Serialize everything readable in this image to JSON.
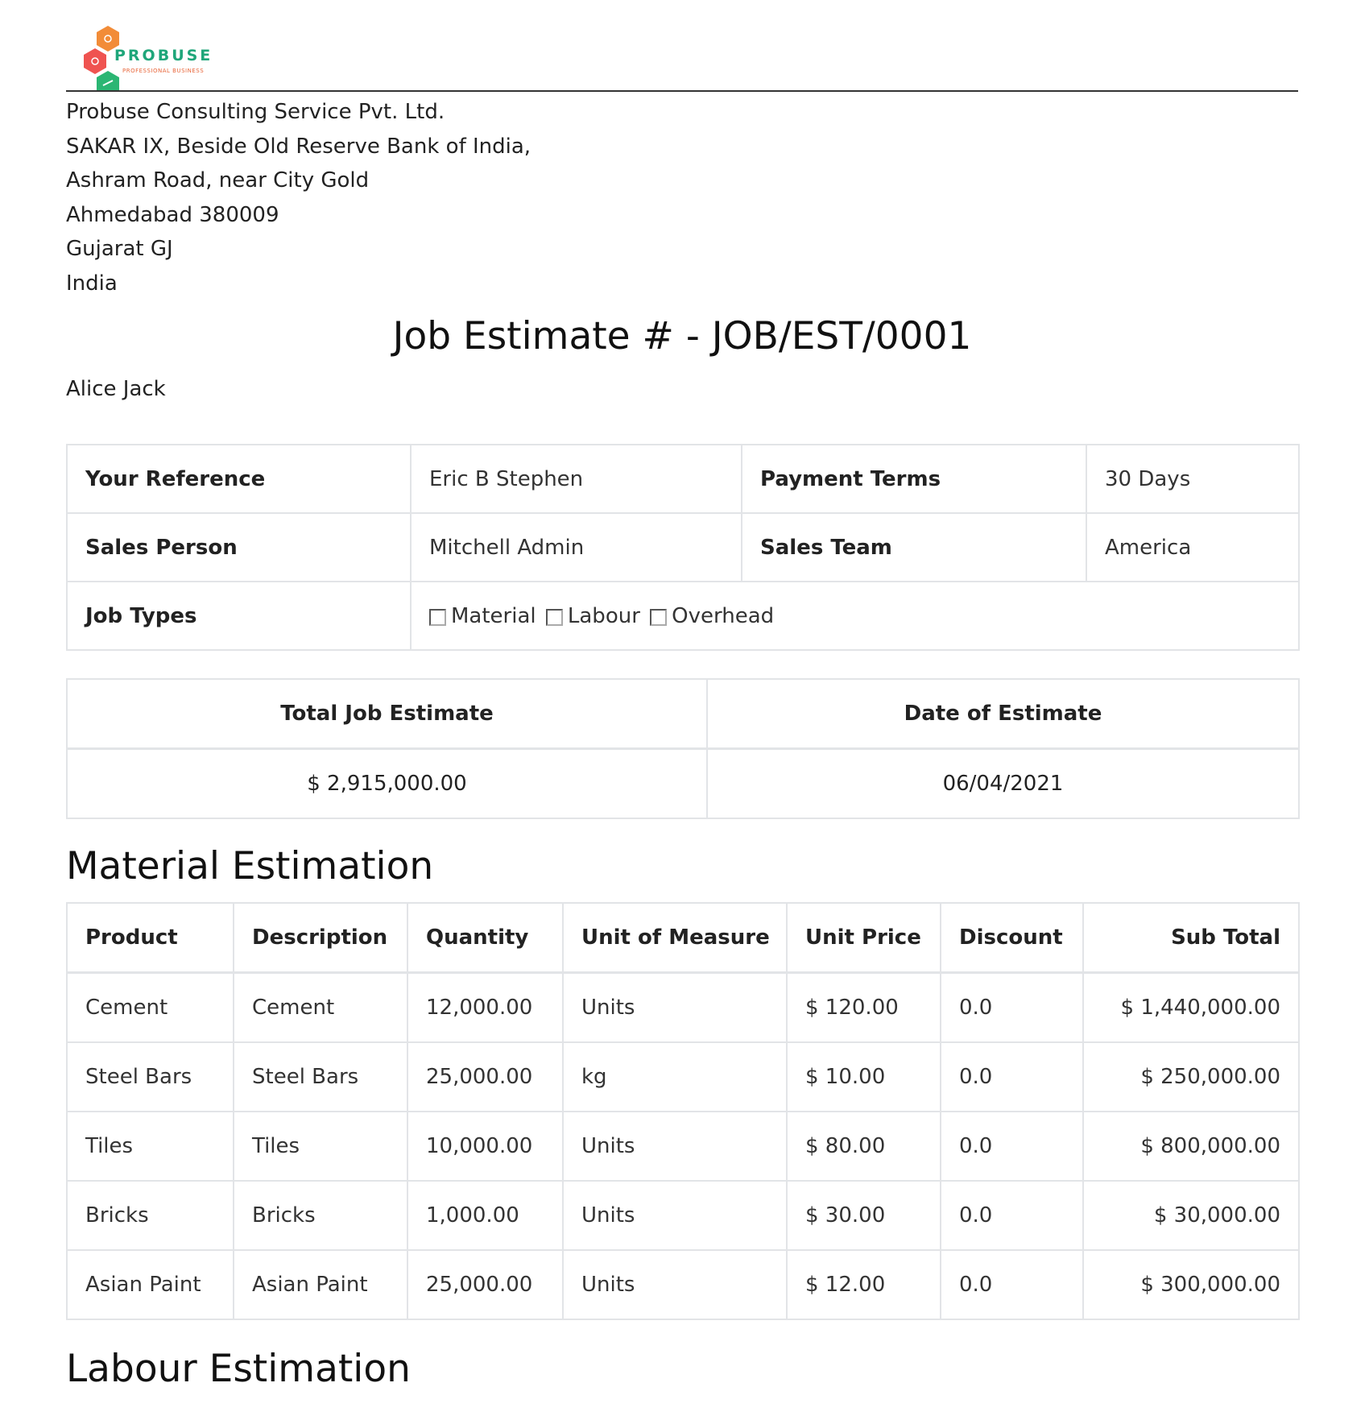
{
  "company": {
    "logo_text": "PROBUSE",
    "logo_tagline": "PROFESSIONAL BUSINESS",
    "address_lines": [
      "Probuse Consulting Service Pvt. Ltd.",
      "SAKAR IX, Beside Old Reserve Bank of India,",
      "Ashram Road, near City Gold",
      "Ahmedabad 380009",
      "Gujarat GJ",
      "India"
    ],
    "brand_colors": {
      "orange": "#f28c38",
      "red": "#ef5350",
      "green": "#2bb673"
    }
  },
  "document": {
    "title": "Job Estimate # - JOB/EST/0001",
    "customer": "Alice Jack"
  },
  "info_table": {
    "your_reference_label": "Your Reference",
    "your_reference_value": "Eric B Stephen",
    "payment_terms_label": "Payment Terms",
    "payment_terms_value": "30 Days",
    "sales_person_label": "Sales Person",
    "sales_person_value": "Mitchell Admin",
    "sales_team_label": "Sales Team",
    "sales_team_value": "America",
    "job_types_label": "Job Types",
    "job_types": [
      {
        "label": "Material",
        "checked": false
      },
      {
        "label": "Labour",
        "checked": false
      },
      {
        "label": "Overhead",
        "checked": false
      }
    ]
  },
  "totals": {
    "total_label": "Total Job Estimate",
    "date_label": "Date of Estimate",
    "total_value": "$ 2,915,000.00",
    "date_value": "06/04/2021"
  },
  "material_section": {
    "title": "Material Estimation",
    "headers": [
      "Product",
      "Description",
      "Quantity",
      "Unit of Measure",
      "Unit Price",
      "Discount",
      "Sub Total"
    ],
    "rows": [
      [
        "Cement",
        "Cement",
        "12,000.00",
        "Units",
        "$ 120.00",
        "0.0",
        "$ 1,440,000.00"
      ],
      [
        "Steel Bars",
        "Steel Bars",
        "25,000.00",
        "kg",
        "$ 10.00",
        "0.0",
        "$ 250,000.00"
      ],
      [
        "Tiles",
        "Tiles",
        "10,000.00",
        "Units",
        "$ 80.00",
        "0.0",
        "$ 800,000.00"
      ],
      [
        "Bricks",
        "Bricks",
        "1,000.00",
        "Units",
        "$ 30.00",
        "0.0",
        "$ 30,000.00"
      ],
      [
        "Asian Paint",
        "Asian Paint",
        "25,000.00",
        "Units",
        "$ 12.00",
        "0.0",
        "$ 300,000.00"
      ]
    ]
  },
  "labour_section": {
    "title": "Labour Estimation"
  }
}
